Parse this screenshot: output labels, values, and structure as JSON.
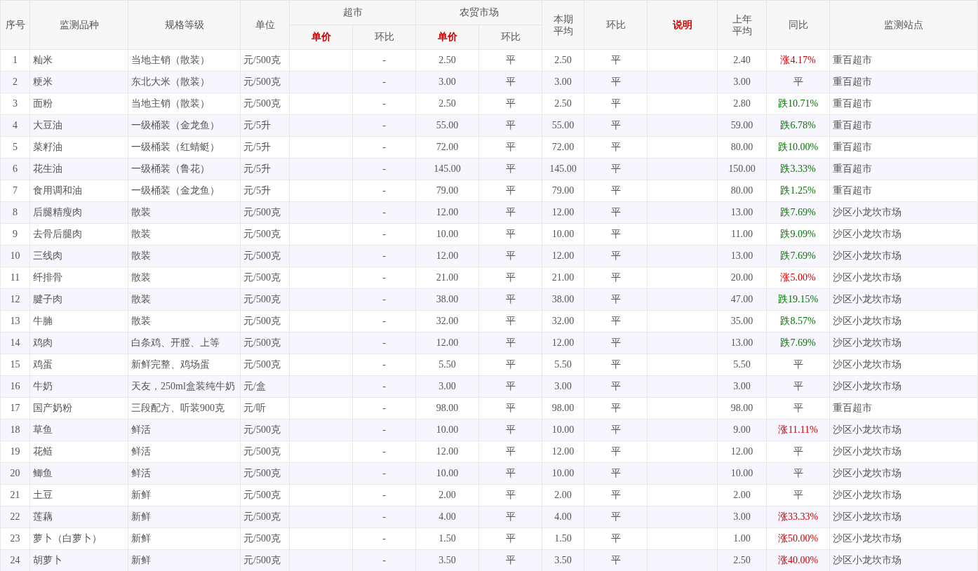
{
  "table": {
    "columns": [
      {
        "label": "序号",
        "emphasis": false
      },
      {
        "label": "监测品种",
        "emphasis": false
      },
      {
        "label": "规格等级",
        "emphasis": false
      },
      {
        "label": "单位",
        "emphasis": false
      },
      {
        "label": "超市",
        "emphasis": false,
        "children": [
          {
            "label": "单价",
            "emphasis": true
          },
          {
            "label": "环比",
            "emphasis": false
          }
        ]
      },
      {
        "label": "农贸市场",
        "emphasis": false,
        "children": [
          {
            "label": "单价",
            "emphasis": true
          },
          {
            "label": "环比",
            "emphasis": false
          }
        ]
      },
      {
        "label": "本期平均",
        "emphasis": false
      },
      {
        "label": "环比",
        "emphasis": false
      },
      {
        "label": "说明",
        "emphasis": true
      },
      {
        "label": "上年平均",
        "emphasis": false
      },
      {
        "label": "同比",
        "emphasis": false
      },
      {
        "label": "监测站点",
        "emphasis": false
      }
    ],
    "rows": [
      {
        "no": "1",
        "item": "籼米",
        "spec": "当地主销（散装）",
        "unit": "元/500克",
        "supermarket_mom": "-",
        "market_price": "2.50",
        "market_mom": "平",
        "current_avg": "2.50",
        "mom": "平",
        "last_year_avg": "2.40",
        "yoy": {
          "text": "涨4.17%",
          "kind": "up"
        },
        "site": "重百超市"
      },
      {
        "no": "2",
        "item": "粳米",
        "spec": "东北大米（散装）",
        "unit": "元/500克",
        "supermarket_mom": "-",
        "market_price": "3.00",
        "market_mom": "平",
        "current_avg": "3.00",
        "mom": "平",
        "last_year_avg": "3.00",
        "yoy": {
          "text": "平",
          "kind": "flat"
        },
        "site": "重百超市"
      },
      {
        "no": "3",
        "item": "面粉",
        "spec": "当地主销（散装）",
        "unit": "元/500克",
        "supermarket_mom": "-",
        "market_price": "2.50",
        "market_mom": "平",
        "current_avg": "2.50",
        "mom": "平",
        "last_year_avg": "2.80",
        "yoy": {
          "text": "跌10.71%",
          "kind": "down"
        },
        "site": "重百超市"
      },
      {
        "no": "4",
        "item": "大豆油",
        "spec": "一级桶装（金龙鱼）",
        "unit": "元/5升",
        "supermarket_mom": "-",
        "market_price": "55.00",
        "market_mom": "平",
        "current_avg": "55.00",
        "mom": "平",
        "last_year_avg": "59.00",
        "yoy": {
          "text": "跌6.78%",
          "kind": "down"
        },
        "site": "重百超市"
      },
      {
        "no": "5",
        "item": "菜籽油",
        "spec": "一级桶装（红蜻蜓）",
        "unit": "元/5升",
        "supermarket_mom": "-",
        "market_price": "72.00",
        "market_mom": "平",
        "current_avg": "72.00",
        "mom": "平",
        "last_year_avg": "80.00",
        "yoy": {
          "text": "跌10.00%",
          "kind": "down"
        },
        "site": "重百超市"
      },
      {
        "no": "6",
        "item": "花生油",
        "spec": "一级桶装（鲁花）",
        "unit": "元/5升",
        "supermarket_mom": "-",
        "market_price": "145.00",
        "market_mom": "平",
        "current_avg": "145.00",
        "mom": "平",
        "last_year_avg": "150.00",
        "yoy": {
          "text": "跌3.33%",
          "kind": "down"
        },
        "site": "重百超市"
      },
      {
        "no": "7",
        "item": "食用调和油",
        "spec": "一级桶装（金龙鱼）",
        "unit": "元/5升",
        "supermarket_mom": "-",
        "market_price": "79.00",
        "market_mom": "平",
        "current_avg": "79.00",
        "mom": "平",
        "last_year_avg": "80.00",
        "yoy": {
          "text": "跌1.25%",
          "kind": "down"
        },
        "site": "重百超市"
      },
      {
        "no": "8",
        "item": "后腿精瘦肉",
        "spec": "散装",
        "unit": "元/500克",
        "supermarket_mom": "-",
        "market_price": "12.00",
        "market_mom": "平",
        "current_avg": "12.00",
        "mom": "平",
        "last_year_avg": "13.00",
        "yoy": {
          "text": "跌7.69%",
          "kind": "down"
        },
        "site": "沙区小龙坎市场"
      },
      {
        "no": "9",
        "item": "去骨后腿肉",
        "spec": "散装",
        "unit": "元/500克",
        "supermarket_mom": "-",
        "market_price": "10.00",
        "market_mom": "平",
        "current_avg": "10.00",
        "mom": "平",
        "last_year_avg": "11.00",
        "yoy": {
          "text": "跌9.09%",
          "kind": "down"
        },
        "site": "沙区小龙坎市场"
      },
      {
        "no": "10",
        "item": "三线肉",
        "spec": "散装",
        "unit": "元/500克",
        "supermarket_mom": "-",
        "market_price": "12.00",
        "market_mom": "平",
        "current_avg": "12.00",
        "mom": "平",
        "last_year_avg": "13.00",
        "yoy": {
          "text": "跌7.69%",
          "kind": "down"
        },
        "site": "沙区小龙坎市场"
      },
      {
        "no": "11",
        "item": "纤排骨",
        "spec": "散装",
        "unit": "元/500克",
        "supermarket_mom": "-",
        "market_price": "21.00",
        "market_mom": "平",
        "current_avg": "21.00",
        "mom": "平",
        "last_year_avg": "20.00",
        "yoy": {
          "text": "涨5.00%",
          "kind": "up"
        },
        "site": "沙区小龙坎市场"
      },
      {
        "no": "12",
        "item": "腱子肉",
        "spec": "散装",
        "unit": "元/500克",
        "supermarket_mom": "-",
        "market_price": "38.00",
        "market_mom": "平",
        "current_avg": "38.00",
        "mom": "平",
        "last_year_avg": "47.00",
        "yoy": {
          "text": "跌19.15%",
          "kind": "down"
        },
        "site": "沙区小龙坎市场"
      },
      {
        "no": "13",
        "item": "牛腩",
        "spec": "散装",
        "unit": "元/500克",
        "supermarket_mom": "-",
        "market_price": "32.00",
        "market_mom": "平",
        "current_avg": "32.00",
        "mom": "平",
        "last_year_avg": "35.00",
        "yoy": {
          "text": "跌8.57%",
          "kind": "down"
        },
        "site": "沙区小龙坎市场"
      },
      {
        "no": "14",
        "item": "鸡肉",
        "spec": "白条鸡、开膛、上等",
        "unit": "元/500克",
        "supermarket_mom": "-",
        "market_price": "12.00",
        "market_mom": "平",
        "current_avg": "12.00",
        "mom": "平",
        "last_year_avg": "13.00",
        "yoy": {
          "text": "跌7.69%",
          "kind": "down"
        },
        "site": "沙区小龙坎市场"
      },
      {
        "no": "15",
        "item": "鸡蛋",
        "spec": "新鲜完整、鸡场蛋",
        "unit": "元/500克",
        "supermarket_mom": "-",
        "market_price": "5.50",
        "market_mom": "平",
        "current_avg": "5.50",
        "mom": "平",
        "last_year_avg": "5.50",
        "yoy": {
          "text": "平",
          "kind": "flat"
        },
        "site": "沙区小龙坎市场"
      },
      {
        "no": "16",
        "item": "牛奶",
        "spec": "天友，250ml盒装纯牛奶",
        "unit": "元/盒",
        "supermarket_mom": "-",
        "market_price": "3.00",
        "market_mom": "平",
        "current_avg": "3.00",
        "mom": "平",
        "last_year_avg": "3.00",
        "yoy": {
          "text": "平",
          "kind": "flat"
        },
        "site": "沙区小龙坎市场"
      },
      {
        "no": "17",
        "item": "国产奶粉",
        "spec": "三段配方、听装900克",
        "unit": "元/听",
        "supermarket_mom": "-",
        "market_price": "98.00",
        "market_mom": "平",
        "current_avg": "98.00",
        "mom": "平",
        "last_year_avg": "98.00",
        "yoy": {
          "text": "平",
          "kind": "flat"
        },
        "site": "重百超市"
      },
      {
        "no": "18",
        "item": "草鱼",
        "spec": "鲜活",
        "unit": "元/500克",
        "supermarket_mom": "-",
        "market_price": "10.00",
        "market_mom": "平",
        "current_avg": "10.00",
        "mom": "平",
        "last_year_avg": "9.00",
        "yoy": {
          "text": "涨11.11%",
          "kind": "up"
        },
        "site": "沙区小龙坎市场"
      },
      {
        "no": "19",
        "item": "花鲢",
        "spec": "鲜活",
        "unit": "元/500克",
        "supermarket_mom": "-",
        "market_price": "12.00",
        "market_mom": "平",
        "current_avg": "12.00",
        "mom": "平",
        "last_year_avg": "12.00",
        "yoy": {
          "text": "平",
          "kind": "flat"
        },
        "site": "沙区小龙坎市场"
      },
      {
        "no": "20",
        "item": "鲫鱼",
        "spec": "鲜活",
        "unit": "元/500克",
        "supermarket_mom": "-",
        "market_price": "10.00",
        "market_mom": "平",
        "current_avg": "10.00",
        "mom": "平",
        "last_year_avg": "10.00",
        "yoy": {
          "text": "平",
          "kind": "flat"
        },
        "site": "沙区小龙坎市场"
      },
      {
        "no": "21",
        "item": "土豆",
        "spec": "新鲜",
        "unit": "元/500克",
        "supermarket_mom": "-",
        "market_price": "2.00",
        "market_mom": "平",
        "current_avg": "2.00",
        "mom": "平",
        "last_year_avg": "2.00",
        "yoy": {
          "text": "平",
          "kind": "flat"
        },
        "site": "沙区小龙坎市场"
      },
      {
        "no": "22",
        "item": "莲藕",
        "spec": "新鲜",
        "unit": "元/500克",
        "supermarket_mom": "-",
        "market_price": "4.00",
        "market_mom": "平",
        "current_avg": "4.00",
        "mom": "平",
        "last_year_avg": "3.00",
        "yoy": {
          "text": "涨33.33%",
          "kind": "up"
        },
        "site": "沙区小龙坎市场"
      },
      {
        "no": "23",
        "item": "萝卜（白萝卜）",
        "spec": "新鲜",
        "unit": "元/500克",
        "supermarket_mom": "-",
        "market_price": "1.50",
        "market_mom": "平",
        "current_avg": "1.50",
        "mom": "平",
        "last_year_avg": "1.00",
        "yoy": {
          "text": "涨50.00%",
          "kind": "up"
        },
        "site": "沙区小龙坎市场"
      },
      {
        "no": "24",
        "item": "胡萝卜",
        "spec": "新鲜",
        "unit": "元/500克",
        "supermarket_mom": "-",
        "market_price": "3.50",
        "market_mom": "平",
        "current_avg": "3.50",
        "mom": "平",
        "last_year_avg": "2.50",
        "yoy": {
          "text": "涨40.00%",
          "kind": "up"
        },
        "site": "沙区小龙坎市场"
      }
    ]
  }
}
